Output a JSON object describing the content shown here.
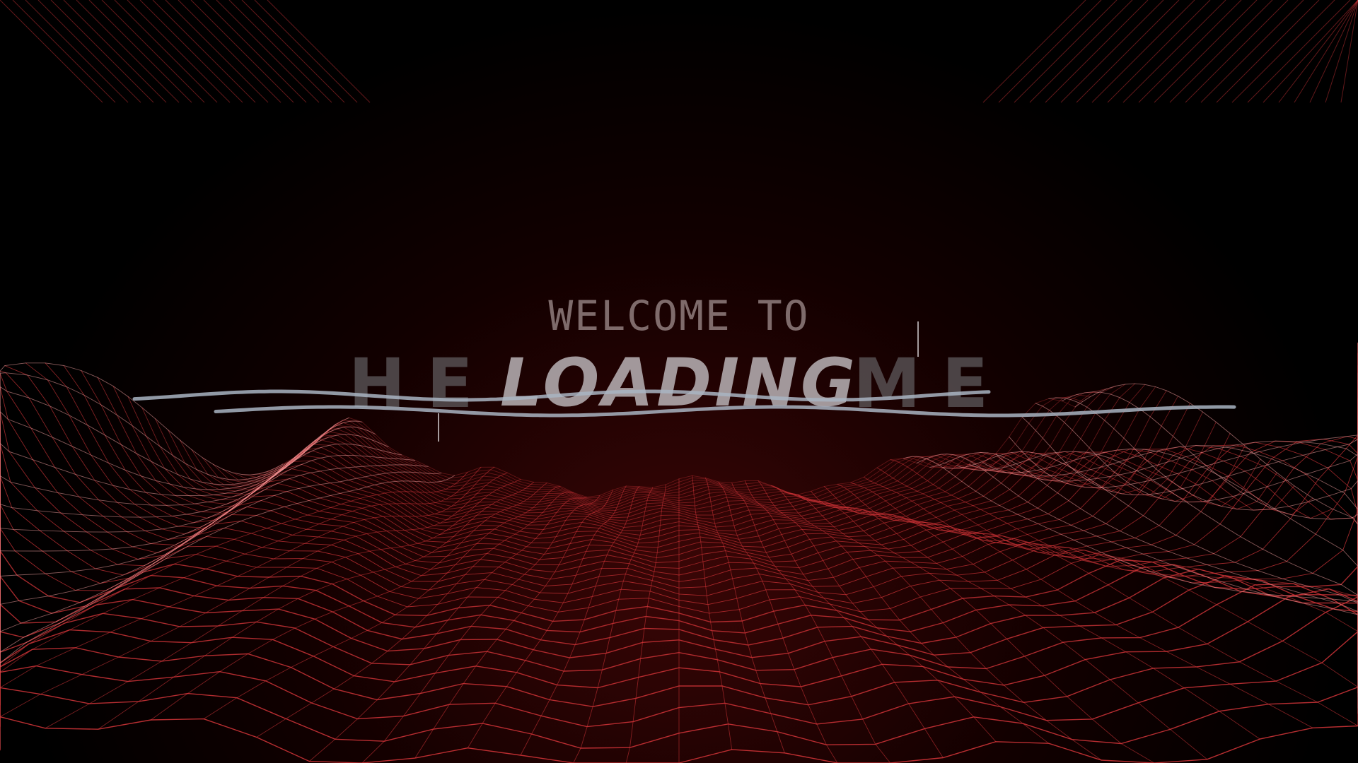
{
  "splash": {
    "welcome_text": "WELCOME TO",
    "title": "LOADING",
    "ghost_text": "HE        ME"
  },
  "colors": {
    "background": "#000000",
    "wireframe": "#d8363a",
    "text": "#b9b3b6",
    "wave": "#a9b4c2"
  },
  "decorations": [
    "corner-stripes-left",
    "corner-stripes-right",
    "wireframe-terrain",
    "glitch-waves"
  ]
}
